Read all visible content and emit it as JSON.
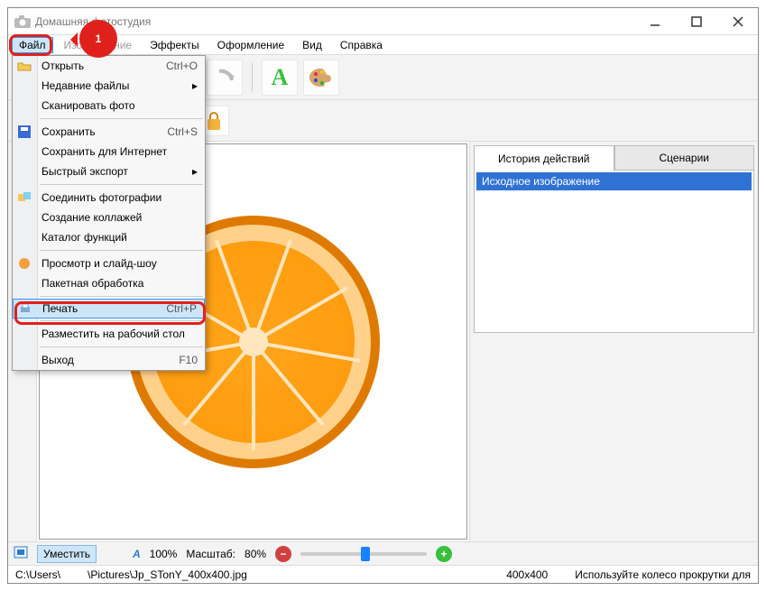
{
  "title": "Домашняя фотостудия",
  "badge_number": "1",
  "menubar": [
    "Файл",
    "Изображение",
    "Эффекты",
    "Оформление",
    "Вид",
    "Справка"
  ],
  "dropdown": {
    "open": {
      "label": "Открыть",
      "shortcut": "Ctrl+O"
    },
    "recent": {
      "label": "Недавние файлы"
    },
    "scan": {
      "label": "Сканировать фото"
    },
    "save": {
      "label": "Сохранить",
      "shortcut": "Ctrl+S"
    },
    "save_web": {
      "label": "Сохранить для Интернет"
    },
    "quick_export": {
      "label": "Быстрый экспорт"
    },
    "merge": {
      "label": "Соединить фотографии"
    },
    "collage": {
      "label": "Создание коллажей"
    },
    "catalog": {
      "label": "Каталог функций"
    },
    "slideshow": {
      "label": "Просмотр и слайд-шоу"
    },
    "batch": {
      "label": "Пакетная обработка"
    },
    "print": {
      "label": "Печать",
      "shortcut": "Ctrl+P"
    },
    "wallpaper": {
      "label": "Разместить на рабочий стол"
    },
    "exit": {
      "label": "Выход",
      "shortcut": "F10"
    }
  },
  "rightpanel": {
    "tab_history": "История действий",
    "tab_scenarios": "Сценарии",
    "history_item": "Исходное изображение"
  },
  "statusbar": {
    "fit": "Уместить",
    "alpha": "100%",
    "scale_label": "Масштаб:",
    "scale_value": "80%"
  },
  "pathbar": {
    "drive": "C:\\Users\\",
    "file": "\\Pictures\\Jp_STonY_400x400.jpg",
    "dims": "400x400",
    "hint": "Используйте колесо прокрутки для"
  },
  "colors": {
    "accent": "#e0211b"
  }
}
